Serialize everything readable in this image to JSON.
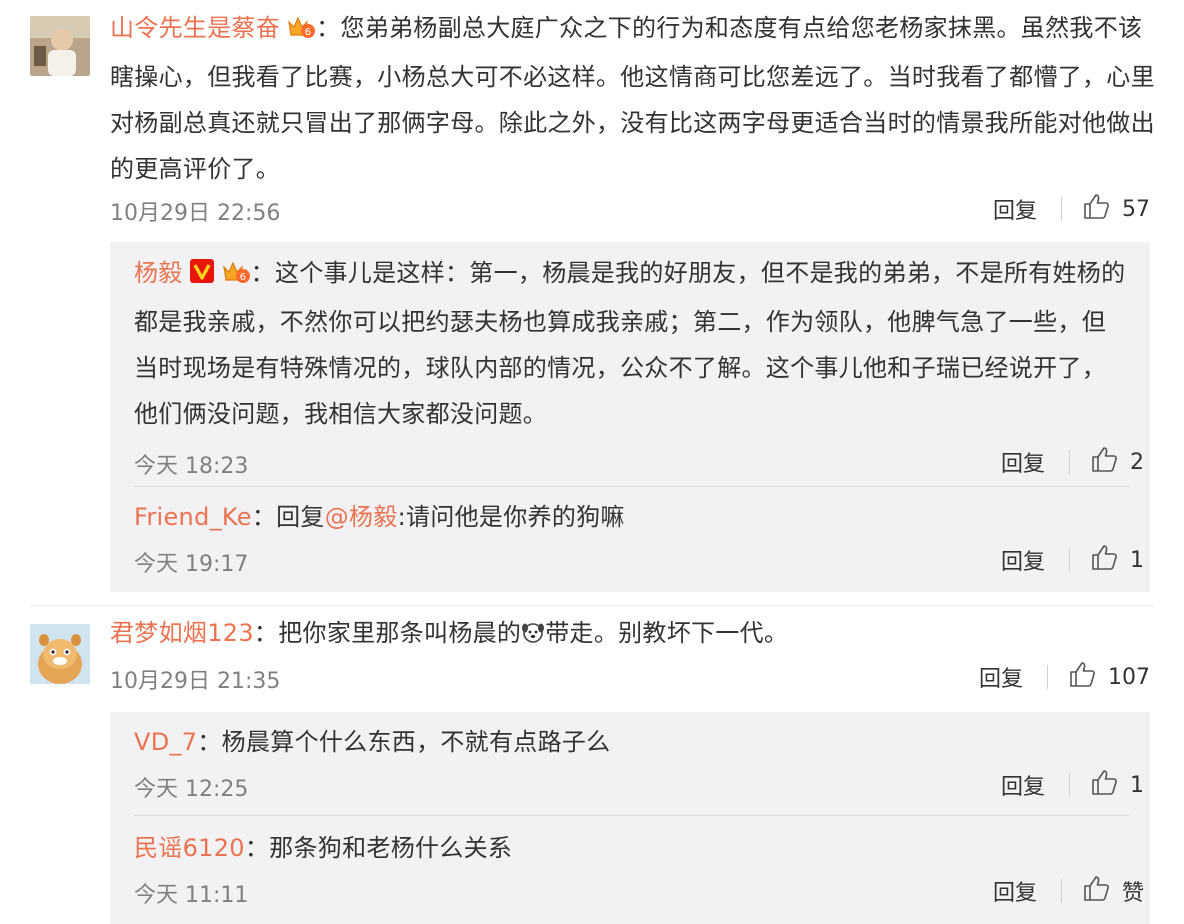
{
  "comments": [
    {
      "username": "山令先生是蔡奋",
      "text": "：您弟弟杨副总大庭广众之下的行为和态度有点给您老杨家抹黑。虽然我不该瞎操心，但我看了比赛，小杨总大可不必这样。他这情商可比您差远了。当时我看了都懵了，心里对杨副总真还就只冒出了那俩字母。除此之外，没有比这两字母更适合当时的情景我所能对他做出的更高评价了。",
      "time": "10月29日 22:56",
      "reply_label": "回复",
      "likes": "57",
      "replies": [
        {
          "username": "杨毅",
          "text": "：这个事儿是这样：第一，杨晨是我的好朋友，但不是我的弟弟，不是所有姓杨的都是我亲戚，不然你可以把约瑟夫杨也算成我亲戚；第二，作为领队，他脾气急了一些，但当时现场是有特殊情况的，球队内部的情况，公众不了解。这个事儿他和子瑞已经说开了，他们俩没问题，我相信大家都没问题。",
          "time": "今天 18:23",
          "reply_label": "回复",
          "likes": "2"
        },
        {
          "username": "Friend_Ke",
          "prefix": "：回复",
          "mention": "@杨毅",
          "text": ":请问他是你养的狗嘛",
          "time": "今天 19:17",
          "reply_label": "回复",
          "likes": "1"
        }
      ]
    },
    {
      "username": "君梦如烟123",
      "text_before": "：把你家里那条叫杨晨的",
      "text_after": "带走。别教坏下一代。",
      "time": "10月29日 21:35",
      "reply_label": "回复",
      "likes": "107",
      "replies": [
        {
          "username": "VD_7",
          "text": "：杨晨算个什么东西，不就有点路子么",
          "time": "今天 12:25",
          "reply_label": "回复",
          "likes": "1"
        },
        {
          "username": "民谣6120",
          "text": "：那条狗和老杨什么关系",
          "time": "今天 11:11",
          "reply_label": "回复",
          "likes": "赞"
        }
      ]
    }
  ],
  "colors": {
    "username": "#eb7350",
    "meta": "#808080",
    "reply_bg": "#f2f2f5"
  },
  "icons": {
    "like": "thumbs-up-icon",
    "verified": "verified-v-icon",
    "vip": "vip-crown-icon",
    "emoji": "dog-emoji-icon"
  }
}
